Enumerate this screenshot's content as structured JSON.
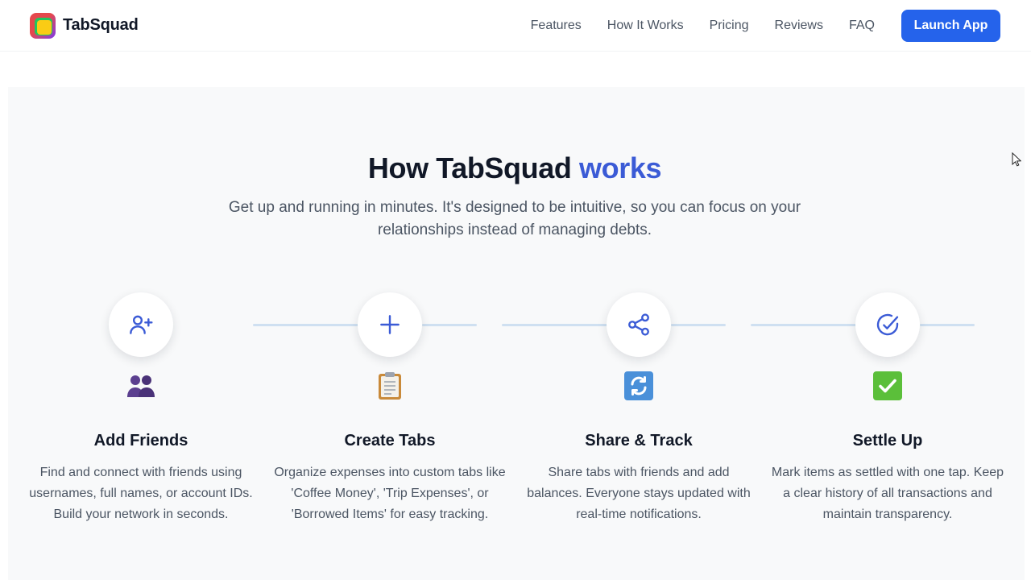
{
  "header": {
    "brand": "TabSquad",
    "nav": [
      "Features",
      "How It Works",
      "Pricing",
      "Reviews",
      "FAQ"
    ],
    "cta": "Launch App",
    "accent_color": "#2563eb"
  },
  "section": {
    "title_main": "How TabSquad ",
    "title_accent": "works",
    "subtitle": "Get up and running in minutes. It's designed to be intuitive, so you can focus on your relationships instead of managing debts.",
    "steps": [
      {
        "icon": "user-plus-icon",
        "emoji": "people-emoji",
        "title": "Add Friends",
        "desc": "Find and connect with friends using usernames, full names, or account IDs. Build your network in seconds."
      },
      {
        "icon": "plus-icon",
        "emoji": "clipboard-emoji",
        "title": "Create Tabs",
        "desc": "Organize expenses into custom tabs like 'Coffee Money', 'Trip Expenses', or 'Borrowed Items' for easy tracking."
      },
      {
        "icon": "share-icon",
        "emoji": "refresh-emoji",
        "title": "Share & Track",
        "desc": "Share tabs with friends and add balances. Everyone stays updated with real-time notifications."
      },
      {
        "icon": "check-circle-icon",
        "emoji": "check-mark-emoji",
        "title": "Settle Up",
        "desc": "Mark items as settled with one tap. Keep a clear history of all transactions and maintain transparency."
      }
    ],
    "icon_color": "#3b5bd6",
    "connector_color": "#cfe0f1"
  }
}
